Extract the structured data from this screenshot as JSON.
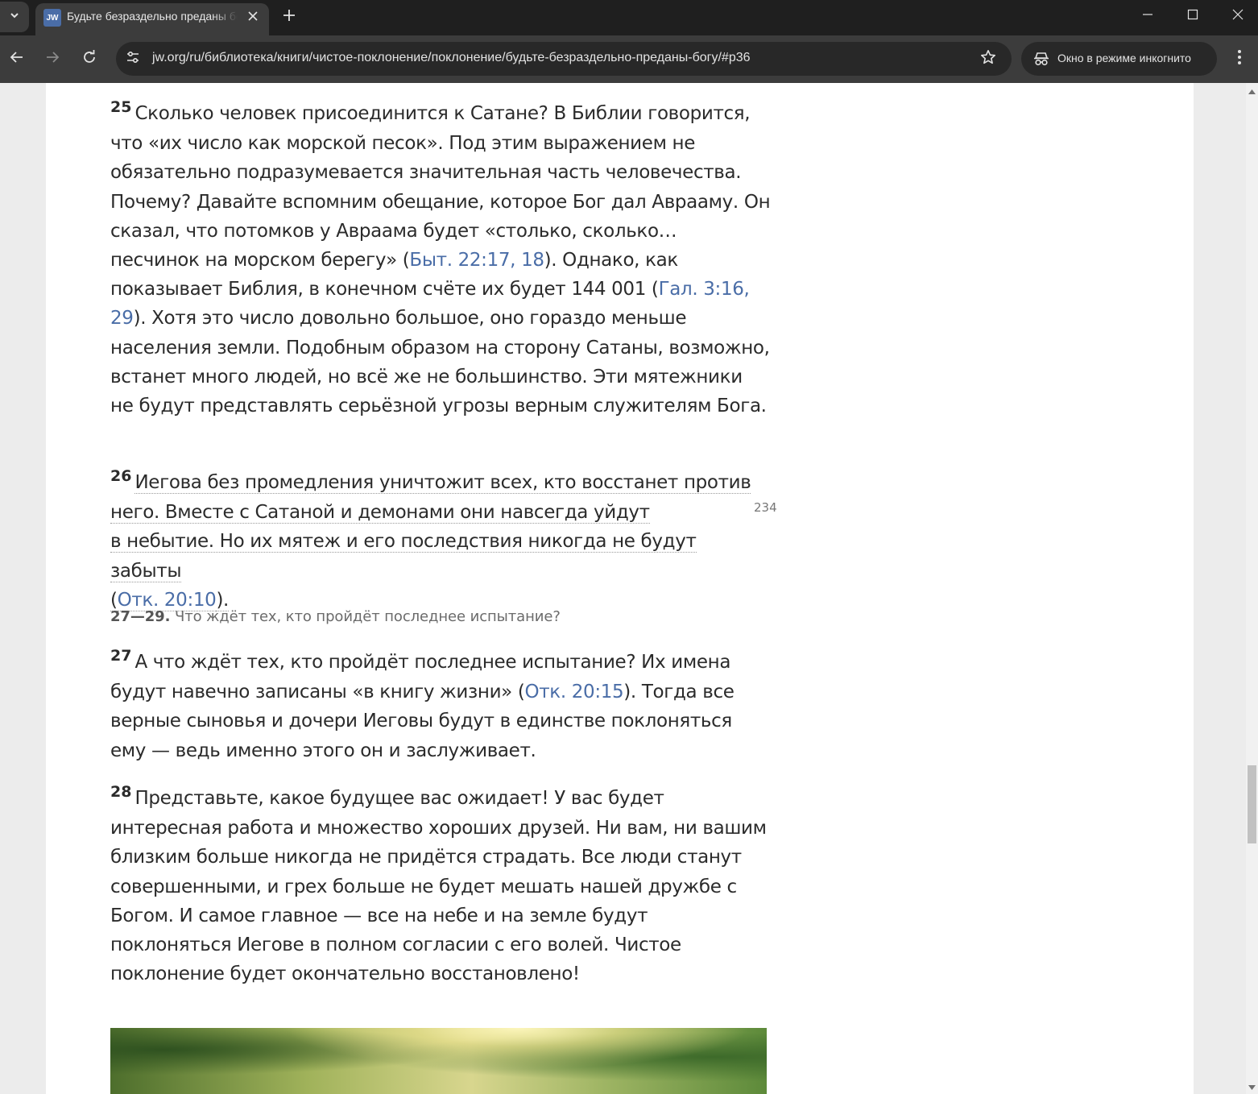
{
  "browser": {
    "tab": {
      "favicon_text": "JW",
      "title": "Будьте безраздельно преданы богу"
    },
    "url": "jw.org/ru/библиотека/книги/чистое-поклонение/поклонение/будьте-безраздельно-преданы-богу/#p36",
    "incognito_label": "Окно в режиме инкогнито",
    "icons": {
      "tab_list": "chevron-down-icon",
      "tab_close": "close-icon",
      "new_tab": "plus-icon",
      "minimize": "minimize-icon",
      "maximize": "maximize-icon",
      "close": "close-icon",
      "back": "arrow-left-icon",
      "forward": "arrow-right-icon",
      "reload": "reload-icon",
      "site_info": "tune-icon",
      "bookmark": "star-icon",
      "incognito": "incognito-icon",
      "menu": "more-vertical-icon"
    },
    "colors": {
      "frame": "#1f1f1f",
      "toolbar": "#3c3c3c",
      "omnibox": "#282828",
      "link": "#4a6da7"
    }
  },
  "article": {
    "p25": {
      "number": "25",
      "text_a": "Сколько человек присоединится к Сатане? В Библии говорится, что «их число как морской песок». Под этим выражением не обязательно подразумевается значительная часть человечества. Почему? Давайте вспомним обещание, которое Бог дал Аврааму. Он сказал, что потомков у Авраама будет «столько, сколько… песчинок на морском берегу» (",
      "ref1": "Быт. 22:17, 18",
      "text_b": "). Однако, как показывает Библия, в конечном счёте их будет 144 001 (",
      "ref2": "Гал. 3:16, 29",
      "text_c": "). Хотя это число довольно большое, оно гораздо меньше населения земли. Подобным образом на сторону Сатаны, возможно, встанет много людей, но всё же не большинство. Эти мятежники не будут представлять серьёзной угрозы верным служителям Бога."
    },
    "p26": {
      "number": "26",
      "line1": "Иегова без промедления уничтожит всех, кто восстанет против",
      "line2": "него. Вместе с Сатаной и демонами они навсегда уйдут",
      "line3": "в небытие. Но их мятеж и его последствия никогда не будут забыты",
      "open": "(",
      "ref": "Отк. 20:10",
      "close": ")."
    },
    "page_marker": "234",
    "question": {
      "range": "27—29.",
      "text": "Что ждёт тех, кто пройдёт последнее испытание?"
    },
    "p27": {
      "number": "27",
      "text_a": "А что ждёт тех, кто пройдёт последнее испытание? Их имена будут навечно записаны «в книгу жизни» (",
      "ref": "Отк. 20:15",
      "text_b": "). Тогда все верные сыновья и дочери Иеговы будут в единстве поклоняться ему — ведь именно этого он и заслуживает."
    },
    "p28": {
      "number": "28",
      "text": "Представьте, какое будущее вас ожидает! У вас будет интересная работа и множество хороших друзей. Ни вам, ни вашим близким больше никогда не придётся страдать. Все люди станут совершенными, и грех больше не будет мешать нашей дружбе с Богом. И самое главное — все на небе и на земле будут поклоняться Иегове в полном согласии с его волей. Чистое поклонение будет окончательно восстановлено!"
    }
  }
}
